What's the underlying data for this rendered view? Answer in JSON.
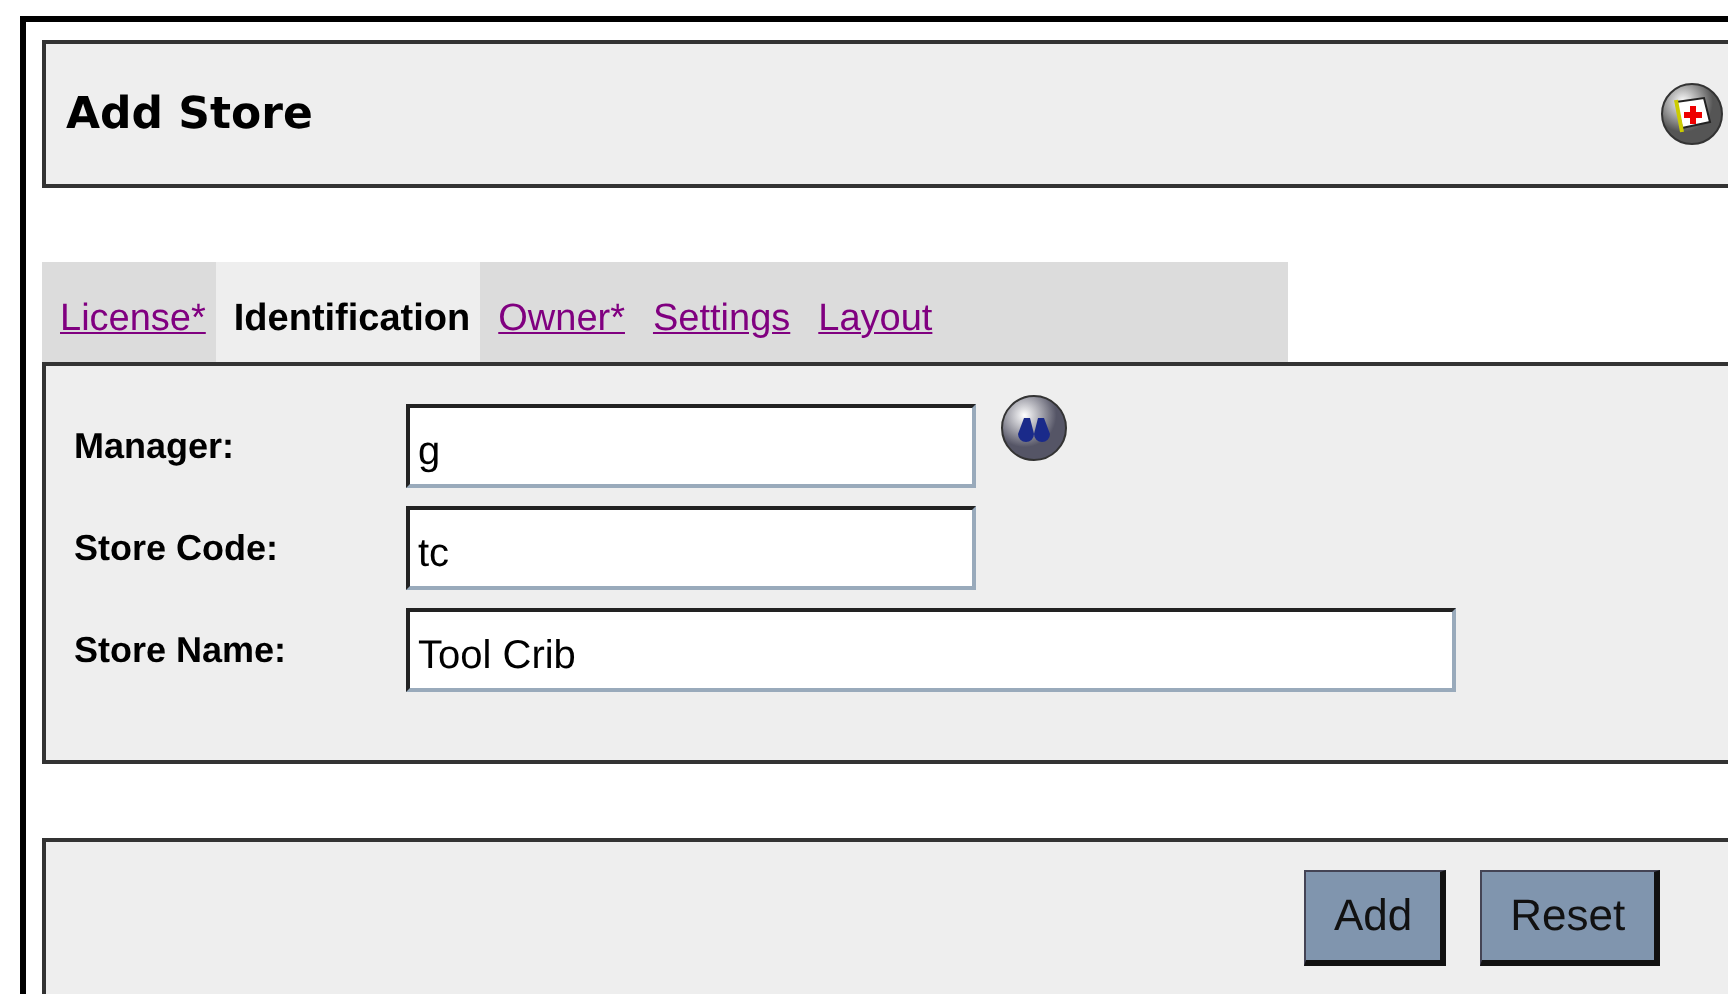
{
  "title": "Add Store",
  "tabs": [
    {
      "label": "License*",
      "selected": false
    },
    {
      "label": "Identification",
      "selected": true
    },
    {
      "label": "Owner*",
      "selected": false
    },
    {
      "label": "Settings",
      "selected": false
    },
    {
      "label": "Layout",
      "selected": false
    }
  ],
  "fields": [
    {
      "label": "Manager:",
      "value": "g",
      "kind": "lookup"
    },
    {
      "label": "Store Code:",
      "value": "tc",
      "kind": "short"
    },
    {
      "label": "Store Name:",
      "value": "Tool Crib",
      "kind": "long"
    }
  ],
  "buttons": [
    "Add",
    "Reset"
  ]
}
